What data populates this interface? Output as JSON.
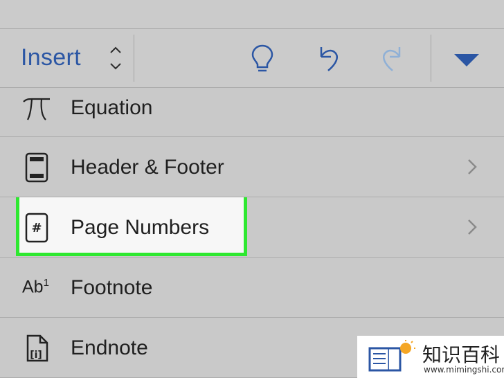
{
  "toolbar": {
    "tab_label": "Insert",
    "buttons": [
      "lightbulb-icon",
      "undo-icon",
      "redo-icon",
      "dropdown-triangle-icon"
    ]
  },
  "menu": {
    "items": [
      {
        "label": "Equation",
        "icon": "pi-icon",
        "has_submenu": false
      },
      {
        "label": "Header & Footer",
        "icon": "header-footer-icon",
        "has_submenu": true
      },
      {
        "label": "Page Numbers",
        "icon": "page-number-icon",
        "has_submenu": true,
        "highlighted": true
      },
      {
        "label": "Footnote",
        "icon": "footnote-icon",
        "icon_text": "Ab",
        "icon_sup": "1",
        "has_submenu": false
      },
      {
        "label": "Endnote",
        "icon": "endnote-icon",
        "has_submenu": false
      }
    ]
  },
  "colors": {
    "accent": "#2b56a4",
    "highlight_border": "#2ee830",
    "background": "#c9c9c9"
  },
  "watermark": {
    "text": "知识百科",
    "url": "www.mimingshi.com"
  }
}
